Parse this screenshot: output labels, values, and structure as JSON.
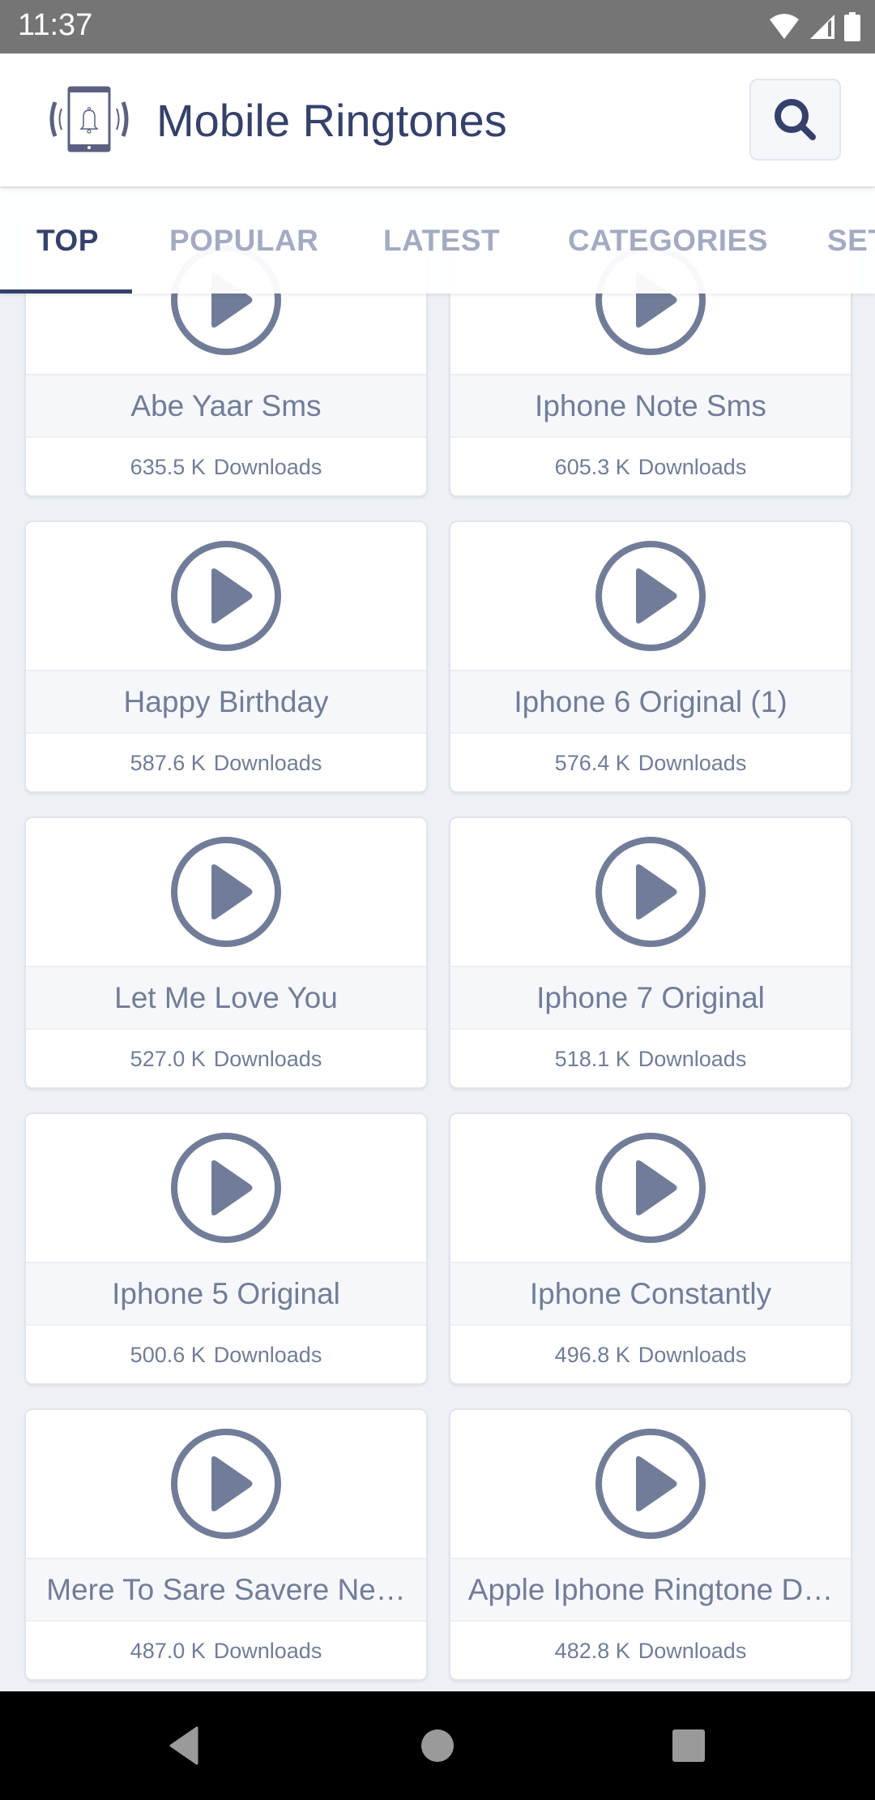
{
  "status_bar": {
    "time": "11:37",
    "icons": [
      "wifi-icon",
      "cellular-signal-icon",
      "battery-icon"
    ]
  },
  "app_bar": {
    "title": "Mobile Ringtones",
    "logo_icon": "phone-ringing-bell-icon",
    "search_icon": "search-icon"
  },
  "tabs": [
    {
      "label": "TOP",
      "active": true
    },
    {
      "label": "POPULAR",
      "active": false
    },
    {
      "label": "LATEST",
      "active": false
    },
    {
      "label": "CATEGORIES",
      "active": false
    },
    {
      "label": "SETTINGS",
      "visible_text": "SET",
      "active": false
    }
  ],
  "colors": {
    "accent": "#35416a",
    "tab_inactive": "#a3abc2",
    "card_text": "#717d98",
    "background": "#edf1f5",
    "title_band": "#f5f7fa",
    "status_bar": "#757575"
  },
  "ringtones": [
    {
      "title": "Abe Yaar Sms",
      "count": "635.5 K",
      "label": "Downloads"
    },
    {
      "title": "Iphone Note Sms",
      "count": "605.3 K",
      "label": "Downloads"
    },
    {
      "title": "Happy Birthday",
      "count": "587.6 K",
      "label": "Downloads"
    },
    {
      "title": "Iphone 6 Original (1)",
      "count": "576.4 K",
      "label": "Downloads"
    },
    {
      "title": "Let Me Love You",
      "count": "527.0 K",
      "label": "Downloads"
    },
    {
      "title": "Iphone 7 Original",
      "count": "518.1 K",
      "label": "Downloads"
    },
    {
      "title": "Iphone 5 Original",
      "count": "500.6 K",
      "label": "Downloads"
    },
    {
      "title": "Iphone Constantly",
      "count": "496.8 K",
      "label": "Downloads"
    },
    {
      "title": "Mere To Sare Savere   Ne…",
      "count": "487.0 K",
      "label": "Downloads"
    },
    {
      "title": "Apple Iphone Ringtone D…",
      "count": "482.8 K",
      "label": "Downloads"
    }
  ],
  "nav_bar": {
    "buttons": [
      "back-icon",
      "home-icon",
      "recents-icon"
    ]
  }
}
